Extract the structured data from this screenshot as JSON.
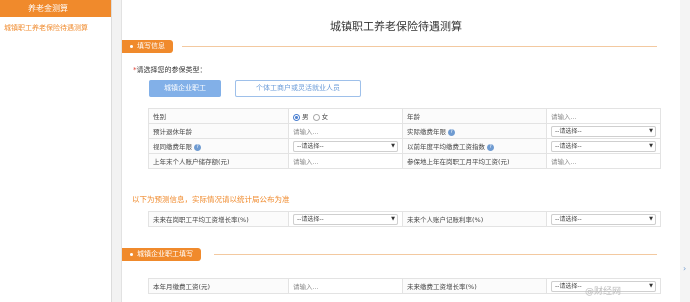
{
  "sidebar": {
    "header": "养老金测算",
    "link": "城镇职工养老保险待遇测算"
  },
  "page": {
    "title": "城镇职工养老保险待遇测算"
  },
  "section1": {
    "tag": "填写信息",
    "required_label": "请选择您的参保类型：",
    "required_star": "*",
    "types": [
      "城镇企业职工",
      "个体工商户或灵活就业人员"
    ]
  },
  "table1": {
    "gender_label": "性别",
    "gender_male": "男",
    "gender_female": "女",
    "age_label": "年龄",
    "age_placeholder": "请输入...",
    "retire_age_label": "预计退休年龄",
    "retire_age_placeholder": "请输入...",
    "paid_years_label": "实际缴费年限",
    "paid_years_value": "--请选择--",
    "deemed_years_label": "视同缴费年限",
    "deemed_years_value": "--请选择--",
    "avg_index_label": "以前年度平均缴费工资指数",
    "avg_index_value": "--请选择--",
    "account_balance_label": "上年末个人账户储存额(元)",
    "account_balance_placeholder": "请输入...",
    "city_wage_label": "参保地上年在岗职工月平均工资(元)",
    "city_wage_placeholder": "请输入..."
  },
  "notice": "以下为预测信息，实际情况请以统计局公布为准",
  "table2": {
    "wage_growth_label": "未来在岗职工平均工资增长率(%)",
    "wage_growth_value": "--请选择--",
    "interest_label": "未来个人账户记账利率(%)",
    "interest_value": "--请选择--"
  },
  "section2": {
    "tag": "城镇企业职工填写"
  },
  "table3": {
    "monthly_wage_label": "本年月缴费工资(元)",
    "monthly_wage_placeholder": "请输入...",
    "future_growth_label": "未来缴费工资增长率(%)",
    "future_growth_value": "--请选择--"
  },
  "watermark": "@财经网",
  "colors": {
    "accent": "#f08a2c",
    "primary_button": "#82b0e8",
    "help_icon": "#6f9bd1"
  }
}
